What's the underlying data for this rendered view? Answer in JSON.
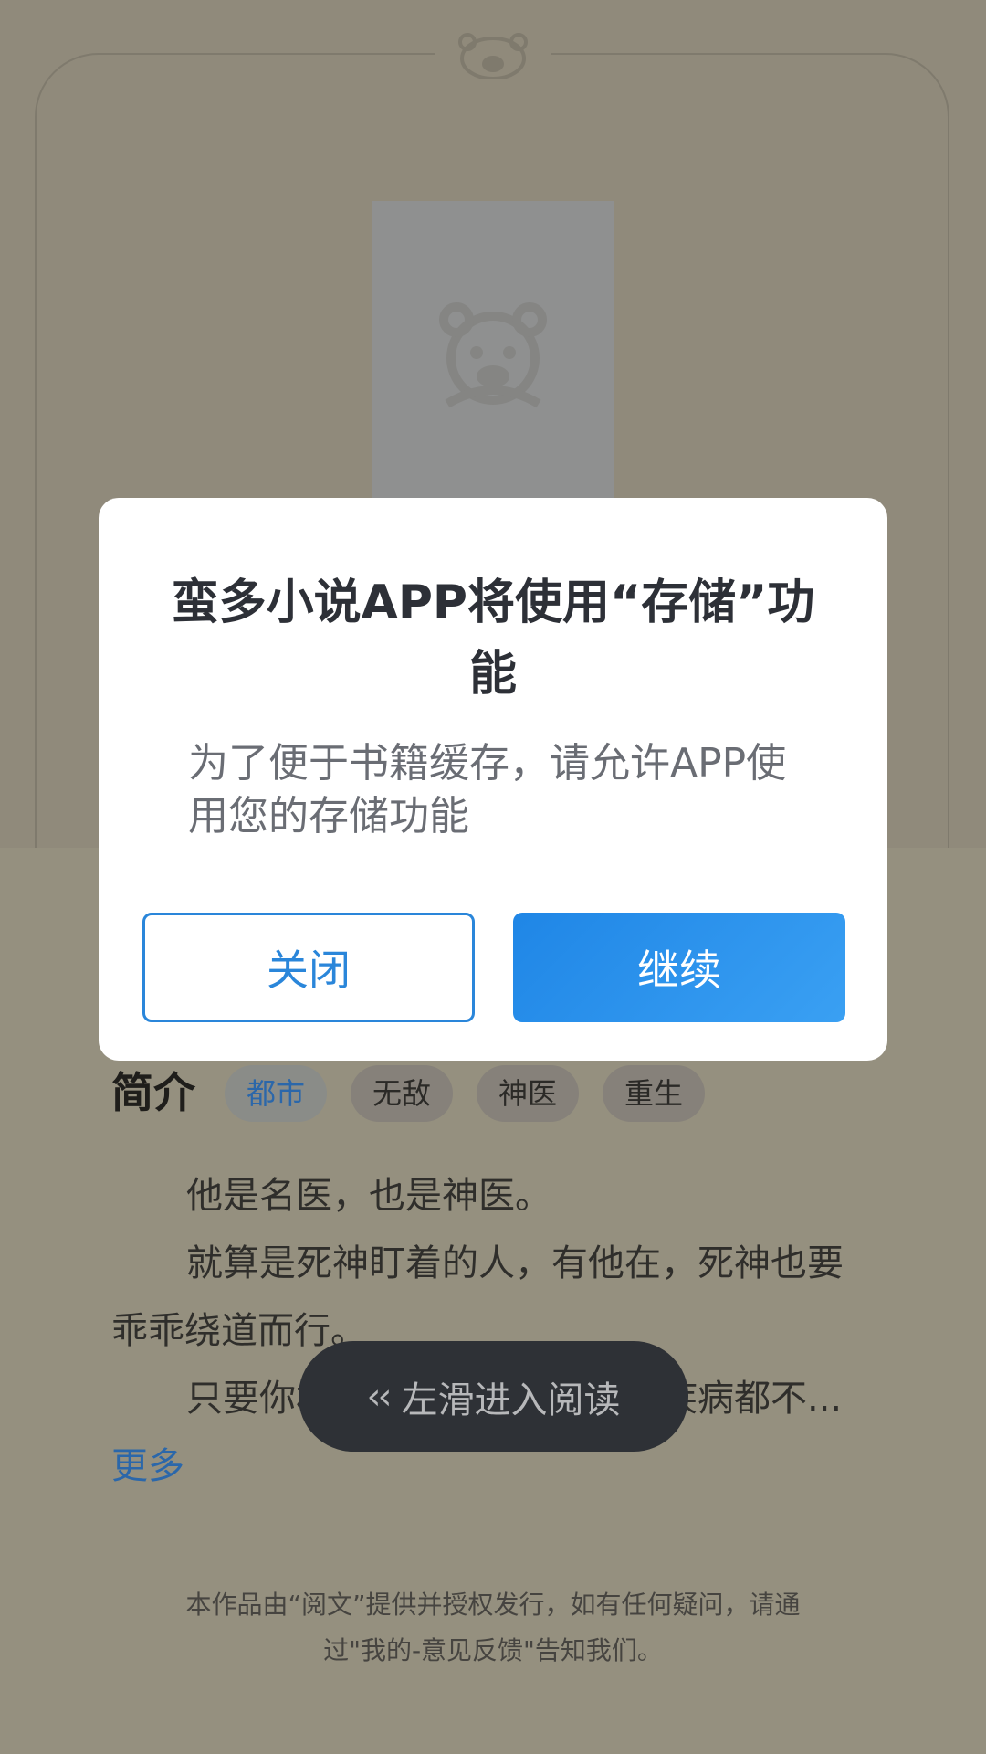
{
  "book": {
    "intro_title": "简介",
    "tags": [
      "都市",
      "无敌",
      "神医",
      "重生"
    ],
    "description": [
      "他是名医，也是神医。",
      "就算是死神盯着的人，有他在，死神也要乖乖绕道而行。",
      "只要你相信他，他能治疗任何疾病都不..."
    ],
    "more_label": "更多"
  },
  "hint": {
    "icon": "chevrons-left-icon",
    "label": "左滑进入阅读"
  },
  "footer_note": "本作品由“阅文”提供并授权发行，如有任何疑问，请通过\"我的-意见反馈\"告知我们。",
  "dialog": {
    "title": "蛮多小说APP将使用“存储”功能",
    "body": "为了便于书籍缓存，请允许APP使用您的存储功能",
    "close_label": "关闭",
    "continue_label": "继续"
  },
  "colors": {
    "overlay_bg": "#908a7b",
    "primary": "#2a86da",
    "link": "#2b67aa"
  }
}
